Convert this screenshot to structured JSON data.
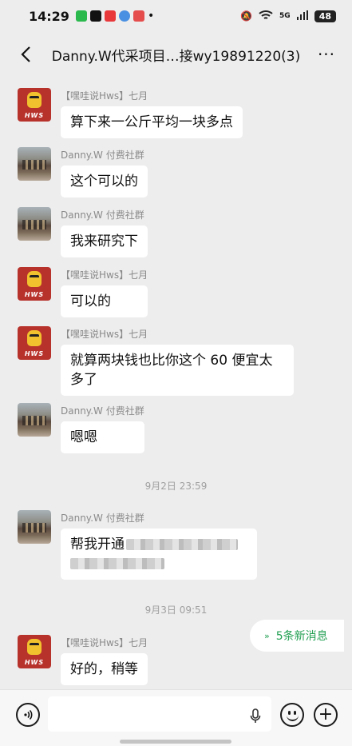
{
  "status_bar": {
    "time": "14:29",
    "app_icons": [
      {
        "name": "wechat-icon",
        "color": "#2bb94e"
      },
      {
        "name": "tiktok-icon",
        "color": "#111111"
      },
      {
        "name": "toutiao-icon",
        "color": "#e8383a"
      },
      {
        "name": "bubble-icon",
        "color": "#4a90e2"
      },
      {
        "name": "music-icon",
        "color": "#e54d4d"
      }
    ],
    "network": "5G",
    "battery": "48"
  },
  "nav": {
    "title": "Danny.W代采项目…接wy19891220(3)"
  },
  "messages": [
    {
      "avatar": "hws",
      "sender": "【嘿哇说Hws】七月",
      "text": "算下来一公斤平均一块多点"
    },
    {
      "avatar": "photo",
      "sender": "Danny.W 付费社群",
      "text": "这个可以的"
    },
    {
      "avatar": "photo",
      "sender": "Danny.W 付费社群",
      "text": "我来研究下"
    },
    {
      "avatar": "hws",
      "sender": "【嘿哇说Hws】七月",
      "text": "可以的"
    },
    {
      "avatar": "hws",
      "sender": "【嘿哇说Hws】七月",
      "text": "就算两块钱也比你这个 60 便宜太多了"
    },
    {
      "avatar": "photo",
      "sender": "Danny.W 付费社群",
      "text": "嗯嗯"
    },
    {
      "avatar": "photo",
      "sender": "Danny.W 付费社群",
      "text": "帮我开通"
    },
    {
      "avatar": "hws",
      "sender": "【嘿哇说Hws】七月",
      "text": "好的，稍等"
    }
  ],
  "time_separators": [
    "9月2日 23:59",
    "9月3日 09:51"
  ],
  "new_messages": {
    "label": "5条新消息",
    "accent": "#23a053"
  },
  "input_bar": {
    "placeholder": ""
  }
}
